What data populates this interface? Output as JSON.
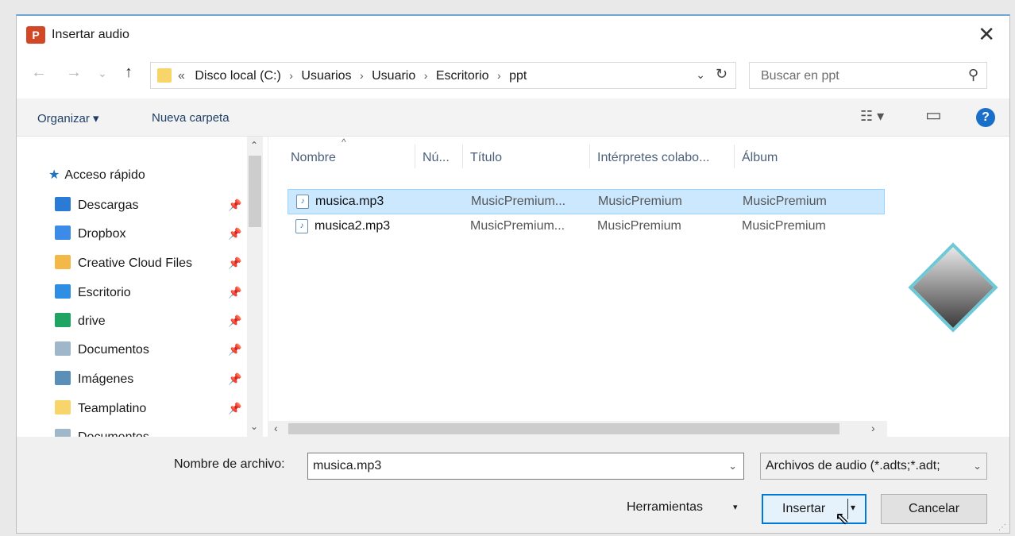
{
  "window": {
    "title": "Insertar audio",
    "app_icon_letter": "P",
    "close_glyph": "✕"
  },
  "nav": {
    "back_glyph": "←",
    "forward_glyph": "→",
    "recent_glyph": "⌄",
    "up_glyph": "↑"
  },
  "address": {
    "prefix": "«",
    "path": [
      "Disco local (C:)",
      "Usuarios",
      "Usuario",
      "Escritorio",
      "ppt"
    ],
    "separator": "›",
    "dropdown_glyph": "⌄",
    "refresh_glyph": "↻"
  },
  "search": {
    "placeholder": "Buscar en ppt",
    "icon_glyph": "⚲"
  },
  "toolbar": {
    "organize_label": "Organizar ▾",
    "new_folder_label": "Nueva carpeta",
    "view_glyph": "☷ ▾",
    "pane_glyph": "▭",
    "help_glyph": "?"
  },
  "sidebar": {
    "items": [
      {
        "label": "Acceso rápido",
        "icon": "star-icon",
        "color": "#1e73be",
        "pinned": false
      },
      {
        "label": "Descargas",
        "icon": "download-icon",
        "color": "#2b7bd6",
        "pinned": true
      },
      {
        "label": "Dropbox",
        "icon": "dropbox-icon",
        "color": "#3d8be8",
        "pinned": true
      },
      {
        "label": "Creative Cloud Files",
        "icon": "creative-cloud-icon",
        "color": "#f4b848",
        "pinned": true
      },
      {
        "label": "Escritorio",
        "icon": "desktop-icon",
        "color": "#2d8ee3",
        "pinned": true
      },
      {
        "label": "drive",
        "icon": "google-drive-icon",
        "color": "#1fa463",
        "pinned": true
      },
      {
        "label": "Documentos",
        "icon": "documents-icon",
        "color": "#9fb7c9",
        "pinned": true
      },
      {
        "label": "Imágenes",
        "icon": "pictures-icon",
        "color": "#5c8fb8",
        "pinned": true
      },
      {
        "label": "Teamplatino",
        "icon": "folder-icon",
        "color": "#f7d56a",
        "pinned": true
      },
      {
        "label": "Documentos",
        "icon": "documents-icon",
        "color": "#9fb7c9",
        "pinned": false
      }
    ],
    "pin_glyph": "📌",
    "scroll_up_glyph": "⌃",
    "scroll_down_glyph": "⌄"
  },
  "filelist": {
    "columns": [
      "Nombre",
      "Nú...",
      "Título",
      "Intérpretes colabo...",
      "Álbum"
    ],
    "sort_glyph": "^",
    "rows": [
      {
        "name": "musica.mp3",
        "number": "",
        "title": "MusicPremium...",
        "artists": "MusicPremium",
        "album": "MusicPremium",
        "selected": true
      },
      {
        "name": "musica2.mp3",
        "number": "",
        "title": "MusicPremium...",
        "artists": "MusicPremium",
        "album": "MusicPremium",
        "selected": false
      }
    ],
    "scroll_left_glyph": "‹",
    "scroll_right_glyph": "›"
  },
  "bottom": {
    "filename_label": "Nombre de archivo:",
    "filename_value": "musica.mp3",
    "filter_value": "Archivos de audio (*.adts;*.adt;",
    "dropdown_glyph": "⌄",
    "tools_label": "Herramientas",
    "tools_glyph": "▾",
    "insert_label": "Insertar",
    "insert_split_glyph": "▾",
    "cancel_label": "Cancelar"
  },
  "colors": {
    "accent": "#0078d7",
    "selection": "#cce8ff",
    "powerpoint": "#d24726"
  }
}
